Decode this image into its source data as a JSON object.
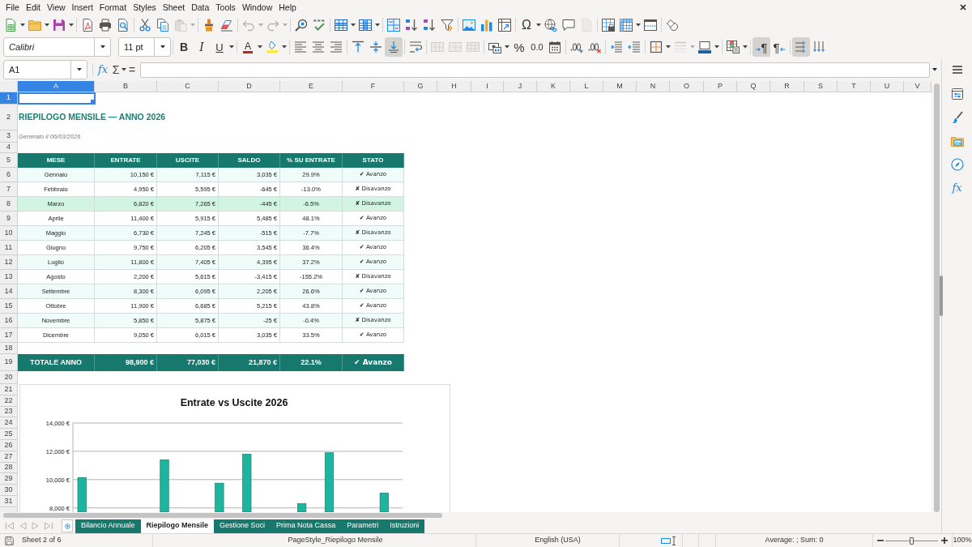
{
  "menu_bar": [
    "File",
    "Edit",
    "View",
    "Insert",
    "Format",
    "Styles",
    "Sheet",
    "Data",
    "Tools",
    "Window",
    "Help"
  ],
  "standard_toolbar": {
    "groups": [
      [
        {
          "kind": "new",
          "disabled": false
        },
        {
          "kind": "open",
          "disabled": false
        },
        {
          "kind": "save",
          "disabled": false
        }
      ],
      [
        {
          "kind": "pdf",
          "disabled": false
        },
        {
          "kind": "print",
          "disabled": false
        },
        {
          "kind": "preview",
          "disabled": false
        }
      ],
      [
        {
          "kind": "cut",
          "disabled": false
        },
        {
          "kind": "copy",
          "disabled": false
        },
        {
          "kind": "paste",
          "disabled": true
        }
      ],
      [
        {
          "kind": "clone",
          "disabled": false
        },
        {
          "kind": "clear",
          "disabled": false
        }
      ],
      [
        {
          "kind": "undo",
          "disabled": true
        },
        {
          "kind": "redo",
          "disabled": true
        }
      ],
      [
        {
          "kind": "find",
          "disabled": false
        },
        {
          "kind": "spelling",
          "disabled": false
        }
      ],
      [
        {
          "kind": "row",
          "disabled": false
        },
        {
          "kind": "column",
          "disabled": false
        }
      ],
      [
        {
          "kind": "sort",
          "disabled": false
        },
        {
          "kind": "ascending",
          "disabled": false
        },
        {
          "kind": "descending",
          "disabled": false
        },
        {
          "kind": "autofilter",
          "disabled": false
        }
      ],
      [
        {
          "kind": "image",
          "disabled": false
        },
        {
          "kind": "chart",
          "disabled": false
        },
        {
          "kind": "pivot",
          "disabled": false
        }
      ],
      [
        {
          "kind": "symbol",
          "label": "Ω",
          "disabled": false
        },
        {
          "kind": "hyperlink",
          "disabled": false
        },
        {
          "kind": "comment",
          "disabled": false
        },
        {
          "kind": "headerfooter",
          "disabled": true
        }
      ],
      [
        {
          "kind": "printarea",
          "disabled": false
        },
        {
          "kind": "freeze",
          "disabled": false
        },
        {
          "kind": "split",
          "disabled": false
        }
      ],
      [
        {
          "kind": "shapes",
          "disabled": false
        }
      ]
    ]
  },
  "formatting_toolbar": {
    "font_name": "Calibri",
    "font_size": "11 pt",
    "groups": [
      [
        {
          "kind": "bold",
          "label": "B",
          "pressed": false,
          "disabled": false
        },
        {
          "kind": "italic",
          "label": "I",
          "pressed": false,
          "disabled": false
        },
        {
          "kind": "underline",
          "label": "U",
          "pressed": false,
          "disabled": false
        }
      ],
      [
        {
          "kind": "fontcolor",
          "label": "A",
          "pressed": false,
          "disabled": false
        },
        {
          "kind": "highlight",
          "pressed": false,
          "disabled": false
        }
      ],
      [
        {
          "kind": "left",
          "pressed": false,
          "disabled": false
        },
        {
          "kind": "center",
          "pressed": false,
          "disabled": false
        },
        {
          "kind": "right",
          "pressed": false,
          "disabled": false
        }
      ],
      [
        {
          "kind": "top",
          "pressed": false,
          "disabled": false
        },
        {
          "kind": "middle",
          "pressed": false,
          "disabled": false
        },
        {
          "kind": "bottom",
          "pressed": true,
          "disabled": false
        }
      ],
      [
        {
          "kind": "wrap",
          "pressed": false,
          "disabled": false
        }
      ],
      [
        {
          "kind": "mergecenter",
          "pressed": false,
          "disabled": true
        },
        {
          "kind": "merge",
          "pressed": false,
          "disabled": true
        },
        {
          "kind": "unmerge",
          "pressed": false,
          "disabled": true
        }
      ],
      [
        {
          "kind": "currency",
          "pressed": false,
          "disabled": false
        },
        {
          "kind": "percent",
          "label": "%",
          "pressed": false,
          "disabled": false
        },
        {
          "kind": "number",
          "label": "0.0",
          "pressed": false,
          "disabled": false
        },
        {
          "kind": "date",
          "pressed": false,
          "disabled": false
        }
      ],
      [
        {
          "kind": "adddecimal",
          "pressed": false,
          "disabled": false
        },
        {
          "kind": "deletedecimal",
          "pressed": false,
          "disabled": false
        }
      ],
      [
        {
          "kind": "indent",
          "pressed": false,
          "disabled": false
        },
        {
          "kind": "outdent",
          "pressed": false,
          "disabled": false
        }
      ],
      [
        {
          "kind": "borders",
          "pressed": false,
          "disabled": false
        },
        {
          "kind": "borderstyle",
          "pressed": false,
          "disabled": true
        },
        {
          "kind": "bordercolor",
          "pressed": false,
          "disabled": false
        }
      ],
      [
        {
          "kind": "conditional",
          "pressed": false,
          "disabled": false
        }
      ],
      [
        {
          "kind": "ltr",
          "label": "¶",
          "pressed": true,
          "disabled": false
        },
        {
          "kind": "rtl",
          "label": "¶",
          "pressed": false,
          "disabled": false
        }
      ],
      [
        {
          "kind": "horizontal",
          "pressed": true,
          "disabled": false
        },
        {
          "kind": "vertical",
          "pressed": false,
          "disabled": false
        }
      ]
    ]
  },
  "formula_bar": {
    "name_box": "A1",
    "function_wizard": "fx",
    "autosum": "Σ",
    "equals": "="
  },
  "column_headers": [
    {
      "label": "A",
      "selected": true
    },
    {
      "label": "B",
      "selected": false
    },
    {
      "label": "C",
      "selected": false
    },
    {
      "label": "D",
      "selected": false
    },
    {
      "label": "E",
      "selected": false
    },
    {
      "label": "F",
      "selected": false
    },
    {
      "label": "G",
      "selected": false
    },
    {
      "label": "H",
      "selected": false
    },
    {
      "label": "I",
      "selected": false
    },
    {
      "label": "J",
      "selected": false
    },
    {
      "label": "K",
      "selected": false
    },
    {
      "label": "L",
      "selected": false
    },
    {
      "label": "M",
      "selected": false
    },
    {
      "label": "N",
      "selected": false
    },
    {
      "label": "O",
      "selected": false
    },
    {
      "label": "P",
      "selected": false
    },
    {
      "label": "Q",
      "selected": false
    },
    {
      "label": "R",
      "selected": false
    },
    {
      "label": "S",
      "selected": false
    },
    {
      "label": "T",
      "selected": false
    },
    {
      "label": "U",
      "selected": false
    },
    {
      "label": "V",
      "selected": false
    }
  ],
  "row_headers": [
    {
      "label": "1",
      "selected": true
    },
    {
      "label": "2",
      "selected": false
    },
    {
      "label": "3",
      "selected": false
    },
    {
      "label": "4",
      "selected": false
    },
    {
      "label": "5",
      "selected": false
    },
    {
      "label": "6",
      "selected": false
    },
    {
      "label": "7",
      "selected": false
    },
    {
      "label": "8",
      "selected": false
    },
    {
      "label": "9",
      "selected": false
    },
    {
      "label": "10",
      "selected": false
    },
    {
      "label": "11",
      "selected": false
    },
    {
      "label": "12",
      "selected": false
    },
    {
      "label": "13",
      "selected": false
    },
    {
      "label": "14",
      "selected": false
    },
    {
      "label": "15",
      "selected": false
    },
    {
      "label": "16",
      "selected": false
    },
    {
      "label": "17",
      "selected": false
    },
    {
      "label": "18",
      "selected": false
    },
    {
      "label": "19",
      "selected": false
    },
    {
      "label": "20",
      "selected": false
    },
    {
      "label": "21",
      "selected": false
    },
    {
      "label": "22",
      "selected": false
    },
    {
      "label": "23",
      "selected": false
    },
    {
      "label": "24",
      "selected": false
    },
    {
      "label": "25",
      "selected": false
    },
    {
      "label": "26",
      "selected": false
    },
    {
      "label": "27",
      "selected": false
    },
    {
      "label": "28",
      "selected": false
    },
    {
      "label": "29",
      "selected": false
    },
    {
      "label": "30",
      "selected": false
    },
    {
      "label": "31",
      "selected": false
    }
  ],
  "sheet": {
    "title": "RIEPILOGO MENSILE — ANNO 2026",
    "subtitle": "Generato il 06/03/2026"
  },
  "table": {
    "columns": [
      "MESE",
      "ENTRATE",
      "USCITE",
      "SALDO",
      "% SU ENTRATE",
      "STATO"
    ],
    "rows": [
      {
        "cells": [
          "Gennaio",
          "10,150 €",
          "7,115 €",
          "3,035 €",
          "29.9%",
          "✔ Avanzo"
        ],
        "highlighted": false
      },
      {
        "cells": [
          "Febbraio",
          "4,950 €",
          "5,595 €",
          "-645 €",
          "-13.0%",
          "✘ Disavanzo"
        ],
        "highlighted": false
      },
      {
        "cells": [
          "Marzo",
          "6,820 €",
          "7,265 €",
          "-445 €",
          "-6.5%",
          "✘ Disavanzo"
        ],
        "highlighted": true
      },
      {
        "cells": [
          "Aprile",
          "11,400 €",
          "5,915 €",
          "5,485 €",
          "48.1%",
          "✔ Avanzo"
        ],
        "highlighted": false
      },
      {
        "cells": [
          "Maggio",
          "6,730 €",
          "7,245 €",
          "-515 €",
          "-7.7%",
          "✘ Disavanzo"
        ],
        "highlighted": false
      },
      {
        "cells": [
          "Giugno",
          "9,750 €",
          "6,205 €",
          "3,545 €",
          "36.4%",
          "✔ Avanzo"
        ],
        "highlighted": false
      },
      {
        "cells": [
          "Luglio",
          "11,800 €",
          "7,405 €",
          "4,395 €",
          "37.2%",
          "✔ Avanzo"
        ],
        "highlighted": false
      },
      {
        "cells": [
          "Agosto",
          "2,200 €",
          "5,615 €",
          "-3,415 €",
          "-155.2%",
          "✘ Disavanzo"
        ],
        "highlighted": false
      },
      {
        "cells": [
          "Settembre",
          "8,300 €",
          "6,095 €",
          "2,205 €",
          "26.6%",
          "✔ Avanzo"
        ],
        "highlighted": false
      },
      {
        "cells": [
          "Ottobre",
          "11,900 €",
          "6,685 €",
          "5,215 €",
          "43.8%",
          "✔ Avanzo"
        ],
        "highlighted": false
      },
      {
        "cells": [
          "Novembre",
          "5,850 €",
          "5,875 €",
          "-25 €",
          "-0.4%",
          "✘ Disavanzo"
        ],
        "highlighted": false
      },
      {
        "cells": [
          "Dicembre",
          "9,050 €",
          "6,015 €",
          "3,035 €",
          "33.5%",
          "✔ Avanzo"
        ],
        "highlighted": false
      }
    ],
    "total": [
      "TOTALE ANNO",
      "98,900 €",
      "77,030 €",
      "21,870 €",
      "22.1%",
      "✔ Avanzo"
    ]
  },
  "chart": {
    "chart_data": {
      "type": "bar",
      "title": "Entrate vs Uscite 2026",
      "ylim": [
        7700,
        14000
      ],
      "yticks": [
        {
          "value": 8000,
          "label": "8,000 €"
        },
        {
          "value": 10000,
          "label": "10,000 €"
        },
        {
          "value": 12000,
          "label": "12,000 €"
        },
        {
          "value": 14000,
          "label": "14,000 €"
        }
      ],
      "grid": true,
      "series": [
        {
          "color": "#1db5a0",
          "values": [
            10150,
            null,
            null,
            11400,
            null,
            9750,
            11800,
            null,
            8300,
            11900,
            null,
            9050
          ]
        }
      ]
    }
  },
  "sidebar": [
    {
      "kind": "menu"
    },
    {
      "kind": "properties"
    },
    {
      "kind": "styles"
    },
    {
      "kind": "gallery"
    },
    {
      "kind": "navigator"
    },
    {
      "kind": "functions",
      "label": "fx"
    }
  ],
  "sheet_tabs": {
    "navigation_disabled": true,
    "tabs": [
      {
        "label": "Bilancio Annuale",
        "selected": false
      },
      {
        "label": "Riepilogo Mensile",
        "selected": true
      },
      {
        "label": "Gestione Soci",
        "selected": false
      },
      {
        "label": "Prima Nota Cassa",
        "selected": false
      },
      {
        "label": "Parametri",
        "selected": false
      },
      {
        "label": "Istruzioni",
        "selected": false
      }
    ]
  },
  "status_bar": {
    "sheet_position": "Sheet 2 of 6",
    "page_style": "PageStyle_Riepilogo Mensile",
    "language": "English (USA)",
    "selection_summary": "Average: ; Sum: 0",
    "zoom": {
      "level": 0.5
    },
    "zoom_percent": "100%"
  }
}
